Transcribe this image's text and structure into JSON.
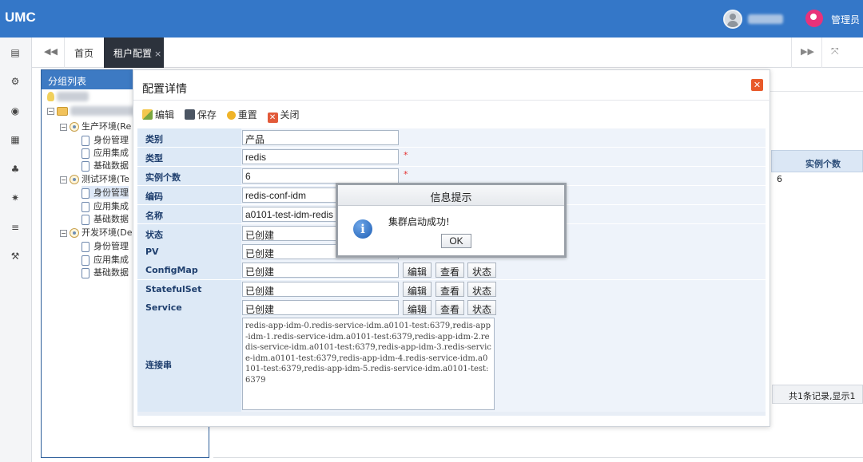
{
  "app": {
    "logo": "UMC",
    "admin_label": "管理员"
  },
  "tabs": {
    "home": "首页",
    "active": "租户配置",
    "active_close": "×"
  },
  "group_panel": {
    "title": "分组列表",
    "environments": [
      {
        "label": "生产环境(Re",
        "children": [
          "身份管理",
          "应用集成",
          "基础数据"
        ]
      },
      {
        "label": "测试环境(Te",
        "children": [
          "身份管理",
          "应用集成",
          "基础数据"
        ]
      },
      {
        "label": "开发环境(De",
        "children": [
          "身份管理",
          "应用集成",
          "基础数据"
        ]
      }
    ]
  },
  "background": {
    "instance_count_header": "实例个数",
    "instance_count_value": "6",
    "pager_text": "共1条记录,显示1"
  },
  "dialog": {
    "title": "配置详情",
    "toolbar": {
      "edit": "编辑",
      "save": "保存",
      "reset": "重置",
      "close": "关闭"
    },
    "fields": {
      "category": {
        "label": "类别",
        "value": "产品"
      },
      "type": {
        "label": "类型",
        "value": "redis"
      },
      "instances": {
        "label": "实例个数",
        "value": "6"
      },
      "code": {
        "label": "编码",
        "value": "redis-conf-idm"
      },
      "name": {
        "label": "名称",
        "value": "a0101-test-idm-redis"
      },
      "status": {
        "label": "状态",
        "value": "已创建"
      },
      "pv": {
        "label": "PV",
        "value": "已创建"
      },
      "configmap": {
        "label": "ConfigMap",
        "value": "已创建"
      },
      "statefulset": {
        "label": "StatefulSet",
        "value": "已创建"
      },
      "service": {
        "label": "Service",
        "value": "已创建"
      },
      "connection": {
        "label": "连接串",
        "value": "redis-app-idm-0.redis-service-idm.a0101-test:6379,redis-app-idm-1.redis-service-idm.a0101-test:6379,redis-app-idm-2.redis-service-idm.a0101-test:6379,redis-app-idm-3.redis-service-idm.a0101-test:6379,redis-app-idm-4.redis-service-idm.a0101-test:6379,redis-app-idm-5.redis-service-idm.a0101-test:6379"
      }
    },
    "row_buttons": {
      "edit": "编辑",
      "view": "查看",
      "status": "状态"
    },
    "required_mark": "*"
  },
  "info_popup": {
    "title": "信息提示",
    "message": "集群启动成功!",
    "ok": "OK"
  }
}
